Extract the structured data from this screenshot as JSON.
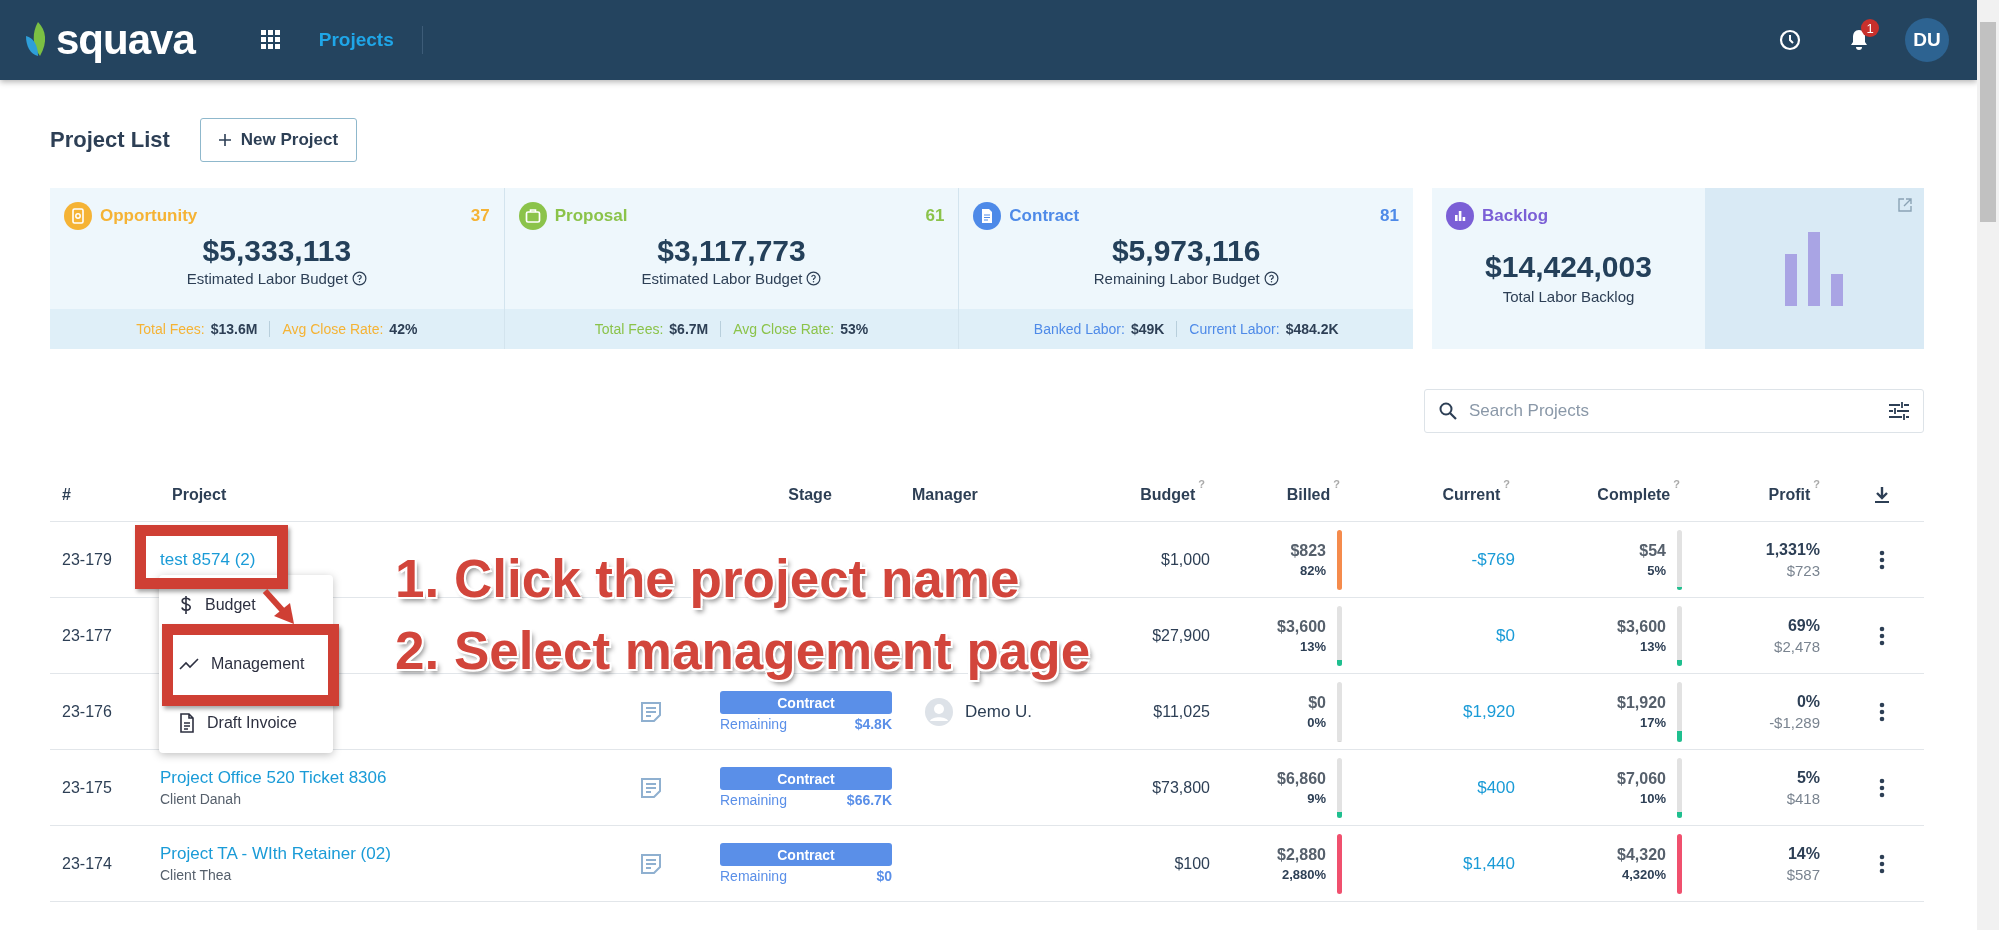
{
  "header": {
    "logo": "squava",
    "nav": [
      {
        "label": "Projects",
        "selected": true
      }
    ],
    "notifications": "1",
    "avatar": "DU"
  },
  "page": {
    "title": "Project List",
    "new_button": "New Project"
  },
  "cards": [
    {
      "kind": "opportunity",
      "title": "Opportunity",
      "count": "37",
      "color": "#f5b335",
      "amount": "$5,333,113",
      "label": "Estimated Labor Budget",
      "stats": [
        {
          "label": "Total Fees:",
          "value": "$13.6M"
        },
        {
          "label": "Avg Close Rate:",
          "value": "42%"
        }
      ]
    },
    {
      "kind": "proposal",
      "title": "Proposal",
      "count": "61",
      "color": "#8bc34a",
      "amount": "$3,117,773",
      "label": "Estimated Labor Budget",
      "stats": [
        {
          "label": "Total Fees:",
          "value": "$6.7M"
        },
        {
          "label": "Avg Close Rate:",
          "value": "53%"
        }
      ]
    },
    {
      "kind": "contract",
      "title": "Contract",
      "count": "81",
      "color": "#4e8ae8",
      "amount": "$5,973,116",
      "label": "Remaining Labor Budget",
      "stats": [
        {
          "label": "Banked Labor:",
          "value": "$49K"
        },
        {
          "label": "Current Labor:",
          "value": "$484.2K"
        }
      ]
    }
  ],
  "backlog": {
    "title": "Backlog",
    "color": "#7b5fd6",
    "amount": "$14,424,003",
    "label": "Total Labor Backlog"
  },
  "search": {
    "placeholder": "Search Projects"
  },
  "table": {
    "columns": [
      {
        "kind": "number",
        "label": "#"
      },
      {
        "kind": "project",
        "label": "Project"
      },
      {
        "kind": "stage",
        "label": "Stage"
      },
      {
        "kind": "manager",
        "label": "Manager"
      },
      {
        "kind": "budget",
        "label": "Budget",
        "help": "?"
      },
      {
        "kind": "billed",
        "label": "Billed",
        "help": "?"
      },
      {
        "kind": "current",
        "label": "Current",
        "help": "?"
      },
      {
        "kind": "complete",
        "label": "Complete",
        "help": "?"
      },
      {
        "kind": "profit",
        "label": "Profit",
        "help": "?"
      }
    ],
    "rows": [
      {
        "number": "23-179",
        "project": {
          "name": "test 8574 (2)"
        },
        "budget": "$1,000",
        "billed": {
          "amount": "$823",
          "pct": "82%",
          "level": 1,
          "color": "#f58b4c"
        },
        "current": "-$769",
        "complete": {
          "amount": "$54",
          "pct": "5%",
          "level": 0.05,
          "color": "#1fbf8f"
        },
        "profit": {
          "pct": "1,331%",
          "amount": "$723"
        }
      },
      {
        "number": "23-177",
        "budget": "$27,900",
        "billed": {
          "amount": "$3,600",
          "pct": "13%",
          "level": 0.1,
          "color": "#1fbf8f"
        },
        "current": "$0",
        "complete": {
          "amount": "$3,600",
          "pct": "13%",
          "level": 0.1,
          "color": "#1fbf8f"
        },
        "profit": {
          "pct": "69%",
          "amount": "$2,478"
        }
      },
      {
        "number": "23-176",
        "note": true,
        "stage": {
          "label": "Contract",
          "remaining_label": "Remaining",
          "remaining": "$4.8K"
        },
        "manager": "Demo U.",
        "budget": "$11,025",
        "billed": {
          "amount": "$0",
          "pct": "0%",
          "level": 0
        },
        "current": "$1,920",
        "complete": {
          "amount": "$1,920",
          "pct": "17%",
          "level": 0.17,
          "color": "#1fbf8f"
        },
        "profit": {
          "pct": "0%",
          "amount": "-$1,289"
        }
      },
      {
        "number": "23-175",
        "project": {
          "name": "Project Office 520 Ticket 8306",
          "client": "Client Danah"
        },
        "note": true,
        "stage": {
          "label": "Contract",
          "remaining_label": "Remaining",
          "remaining": "$66.7K"
        },
        "budget": "$73,800",
        "billed": {
          "amount": "$6,860",
          "pct": "9%",
          "level": 0.09,
          "color": "#1fbf8f"
        },
        "current": "$400",
        "complete": {
          "amount": "$7,060",
          "pct": "10%",
          "level": 0.1,
          "color": "#1fbf8f"
        },
        "profit": {
          "pct": "5%",
          "amount": "$418"
        }
      },
      {
        "number": "23-174",
        "project": {
          "name": "Project TA - WIth Retainer (02)",
          "client": "Client Thea"
        },
        "note": true,
        "stage": {
          "label": "Contract",
          "remaining_label": "Remaining",
          "remaining": "$0"
        },
        "budget": "$100",
        "billed": {
          "amount": "$2,880",
          "pct": "2,880%",
          "level": 1,
          "color": "#f0506e"
        },
        "current": "$1,440",
        "complete": {
          "amount": "$4,320",
          "pct": "4,320%",
          "level": 1,
          "color": "#f0506e"
        },
        "profit": {
          "pct": "14%",
          "amount": "$587"
        }
      }
    ]
  },
  "menu": {
    "items": [
      {
        "kind": "dollar",
        "label": "Budget"
      },
      {
        "kind": "chart",
        "label": "Management"
      },
      {
        "kind": "document",
        "label": "Draft Invoice"
      }
    ]
  },
  "annotation": {
    "steps": [
      "1. Click the project name",
      "2. Select management page"
    ]
  }
}
